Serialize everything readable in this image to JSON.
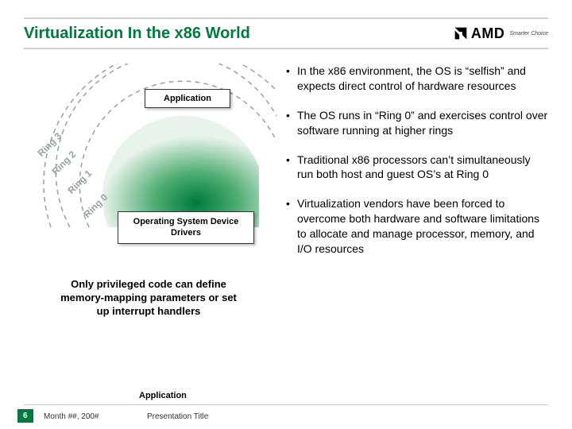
{
  "header": {
    "title": "Virtualization In the x86 World",
    "logo_text": "AMD",
    "logo_tagline": "Smarter Choice"
  },
  "diagram": {
    "application_label": "Application",
    "os_label": "Operating System Device Drivers",
    "rings": {
      "r3": "Ring 3",
      "r2": "Ring 2",
      "r1": "Ring 1",
      "r0": "Ring 0"
    },
    "privileged_text": "Only privileged code can define memory-mapping parameters or set up interrupt handlers"
  },
  "bullets": [
    "In the x86 environment, the OS is “selfish” and expects direct control of hardware resources",
    "The OS runs in “Ring 0” and exercises control over software running at higher rings",
    "Traditional x86 processors can’t simultaneously run both host and guest OS’s at Ring 0",
    "Virtualization vendors have been forced to overcome both hardware and software limitations to allocate and manage processor, memory, and I/O resources"
  ],
  "footer": {
    "application": "Application",
    "page": "6",
    "date": "Month ##, 200#",
    "presentation": "Presentation Title"
  },
  "colors": {
    "brand_green": "#007a3d",
    "ring_grey": "#9aa0a0"
  }
}
